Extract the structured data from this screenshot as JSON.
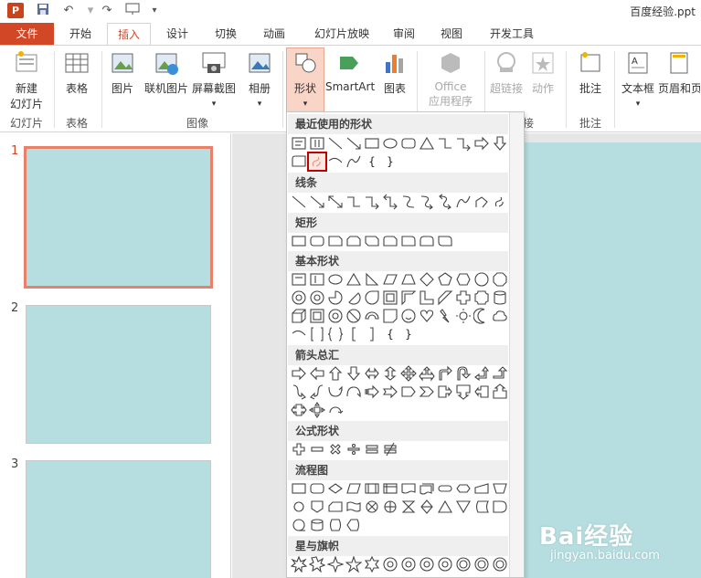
{
  "window": {
    "title": "百度经验.ppt",
    "app_badge": "P"
  },
  "quick_access": {
    "save_icon": "save-icon",
    "undo_icon": "undo-icon",
    "redo_icon": "redo-icon",
    "present_icon": "present-icon"
  },
  "tabs": {
    "file": "文件",
    "items": [
      "开始",
      "插入",
      "设计",
      "切换",
      "动画",
      "幻灯片放映",
      "审阅",
      "视图",
      "开发工具"
    ],
    "active": "插入"
  },
  "ribbon": {
    "new_slide": "新建",
    "new_slide_line2": "幻灯片",
    "table": "表格",
    "picture": "图片",
    "online_picture": "联机图片",
    "screenshot": "屏幕截图",
    "album": "相册",
    "shapes": "形状",
    "smartart": "SmartArt",
    "chart": "图表",
    "office_apps": "Office",
    "office_apps_line2": "应用程序",
    "hyperlink": "超链接",
    "action": "动作",
    "comment": "批注",
    "textbox": "文本框",
    "header_footer": "页眉和页",
    "groups": {
      "slides": "幻灯片",
      "tables": "表格",
      "images": "图像",
      "links": "接",
      "comments": "批注"
    }
  },
  "slides": {
    "numbers": [
      "1",
      "2",
      "3"
    ],
    "selected": "1"
  },
  "shapes_menu": {
    "categories": [
      "最近使用的形状",
      "线条",
      "矩形",
      "基本形状",
      "箭头总汇",
      "公式形状",
      "流程图",
      "星与旗帜"
    ],
    "selected_shape": "freeform-scribble",
    "brace_left": "{",
    "brace_right": "}"
  },
  "watermark": {
    "logo": "Bai经验",
    "url": "jingyan.baidu.com"
  },
  "colors": {
    "accent": "#d24726",
    "slide": "#b6dde0",
    "highlight": "#c00000"
  }
}
